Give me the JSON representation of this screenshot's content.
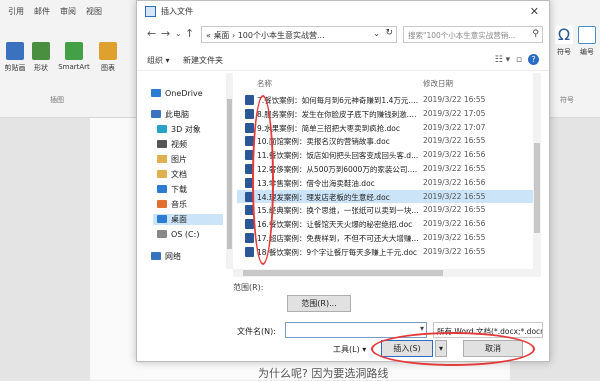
{
  "ribbon": {
    "tabs": [
      "引用",
      "邮件",
      "审阅",
      "视图"
    ],
    "buttons": [
      {
        "label": "剪贴画",
        "color": "#3a72c0"
      },
      {
        "label": "形状",
        "color": "#4a8e3f"
      },
      {
        "label": "SmartArt",
        "color": "#43a047"
      },
      {
        "label": "图表",
        "color": "#e0a030"
      }
    ],
    "group_label": "插图",
    "right_buttons": [
      "符号",
      "编号"
    ],
    "right_group": "符号"
  },
  "document": {
    "text": "为什么呢? 因为要选洞路线"
  },
  "dialog": {
    "title": "插入文件",
    "address": "« 桌面 › 100个小本生意实战营...",
    "search_placeholder": "搜索\"100个小本生意实战营销...",
    "cmd_organize": "组织 ▾",
    "cmd_new_folder": "新建文件夹",
    "leftnav": [
      {
        "label": "OneDrive",
        "color": "#2b7cd3"
      },
      {
        "label": "此电脑",
        "color": "#3a72c0"
      },
      {
        "label": "3D 对象",
        "color": "#28a0c8"
      },
      {
        "label": "视频",
        "color": "#555555"
      },
      {
        "label": "图片",
        "color": "#e0b050"
      },
      {
        "label": "文档",
        "color": "#e0b050"
      },
      {
        "label": "下载",
        "color": "#2b7cd3"
      },
      {
        "label": "音乐",
        "color": "#e07030"
      },
      {
        "label": "桌面",
        "color": "#2b7cd3"
      },
      {
        "label": "OS (C:)",
        "color": "#888888"
      },
      {
        "label": "网络",
        "color": "#3a72c0"
      }
    ],
    "columns": {
      "name": "名称",
      "date": "修改日期"
    },
    "files": [
      {
        "name": "7.餐饮案例：如何每月到6元神奇赚到1.4万元.d...",
        "date": "2019/3/22 16:55"
      },
      {
        "name": "8.服务案例：发生在你脸皮子底下的赚钱刺激.d...",
        "date": "2019/3/22 17:05"
      },
      {
        "name": "9.水果案例：简单三招把大枣卖到疯抢.doc",
        "date": "2019/3/22 17:07"
      },
      {
        "name": "10.面馆案例：卖报名汉的营销故事.doc",
        "date": "2019/3/22 16:55"
      },
      {
        "name": "11.餐饮案例：饭店如何把头回客变成回头客.d...",
        "date": "2019/3/22 16:56"
      },
      {
        "name": "12.奢侈案例：从500万到6000万的家装公司.d...",
        "date": "2019/3/22 16:55"
      },
      {
        "name": "13.零售案例：借令出海卖鞋油.doc",
        "date": "2019/3/22 16:56"
      },
      {
        "name": "14.理发案例：理发店老板的生意经.doc",
        "date": "2019/3/22 16:55"
      },
      {
        "name": "15.经典案例：换个思维，一张纸可以卖到一块...",
        "date": "2019/3/22 16:55"
      },
      {
        "name": "16.餐饮案例：让餐馆天天火爆的秘密绝招.doc",
        "date": "2019/3/22 16:56"
      },
      {
        "name": "17.超店案例：免费样到，不但不可还大大增赚...",
        "date": "2019/3/22 16:55"
      },
      {
        "name": "18.餐饮案例：9个字让餐厅每天多赚上千元.doc",
        "date": "2019/3/22 16:55"
      }
    ],
    "selected_index": 7,
    "range_label": "范围(R):",
    "range_button": "范围(R)...",
    "filename_label": "文件名(N):",
    "filename_value": "",
    "filetype": "所有 Word 文档(*.docx;*.docn ▾",
    "tools_label": "工具(L)",
    "insert_button": "插入(S)",
    "cancel_button": "取消",
    "accent": "#e43a3a"
  }
}
